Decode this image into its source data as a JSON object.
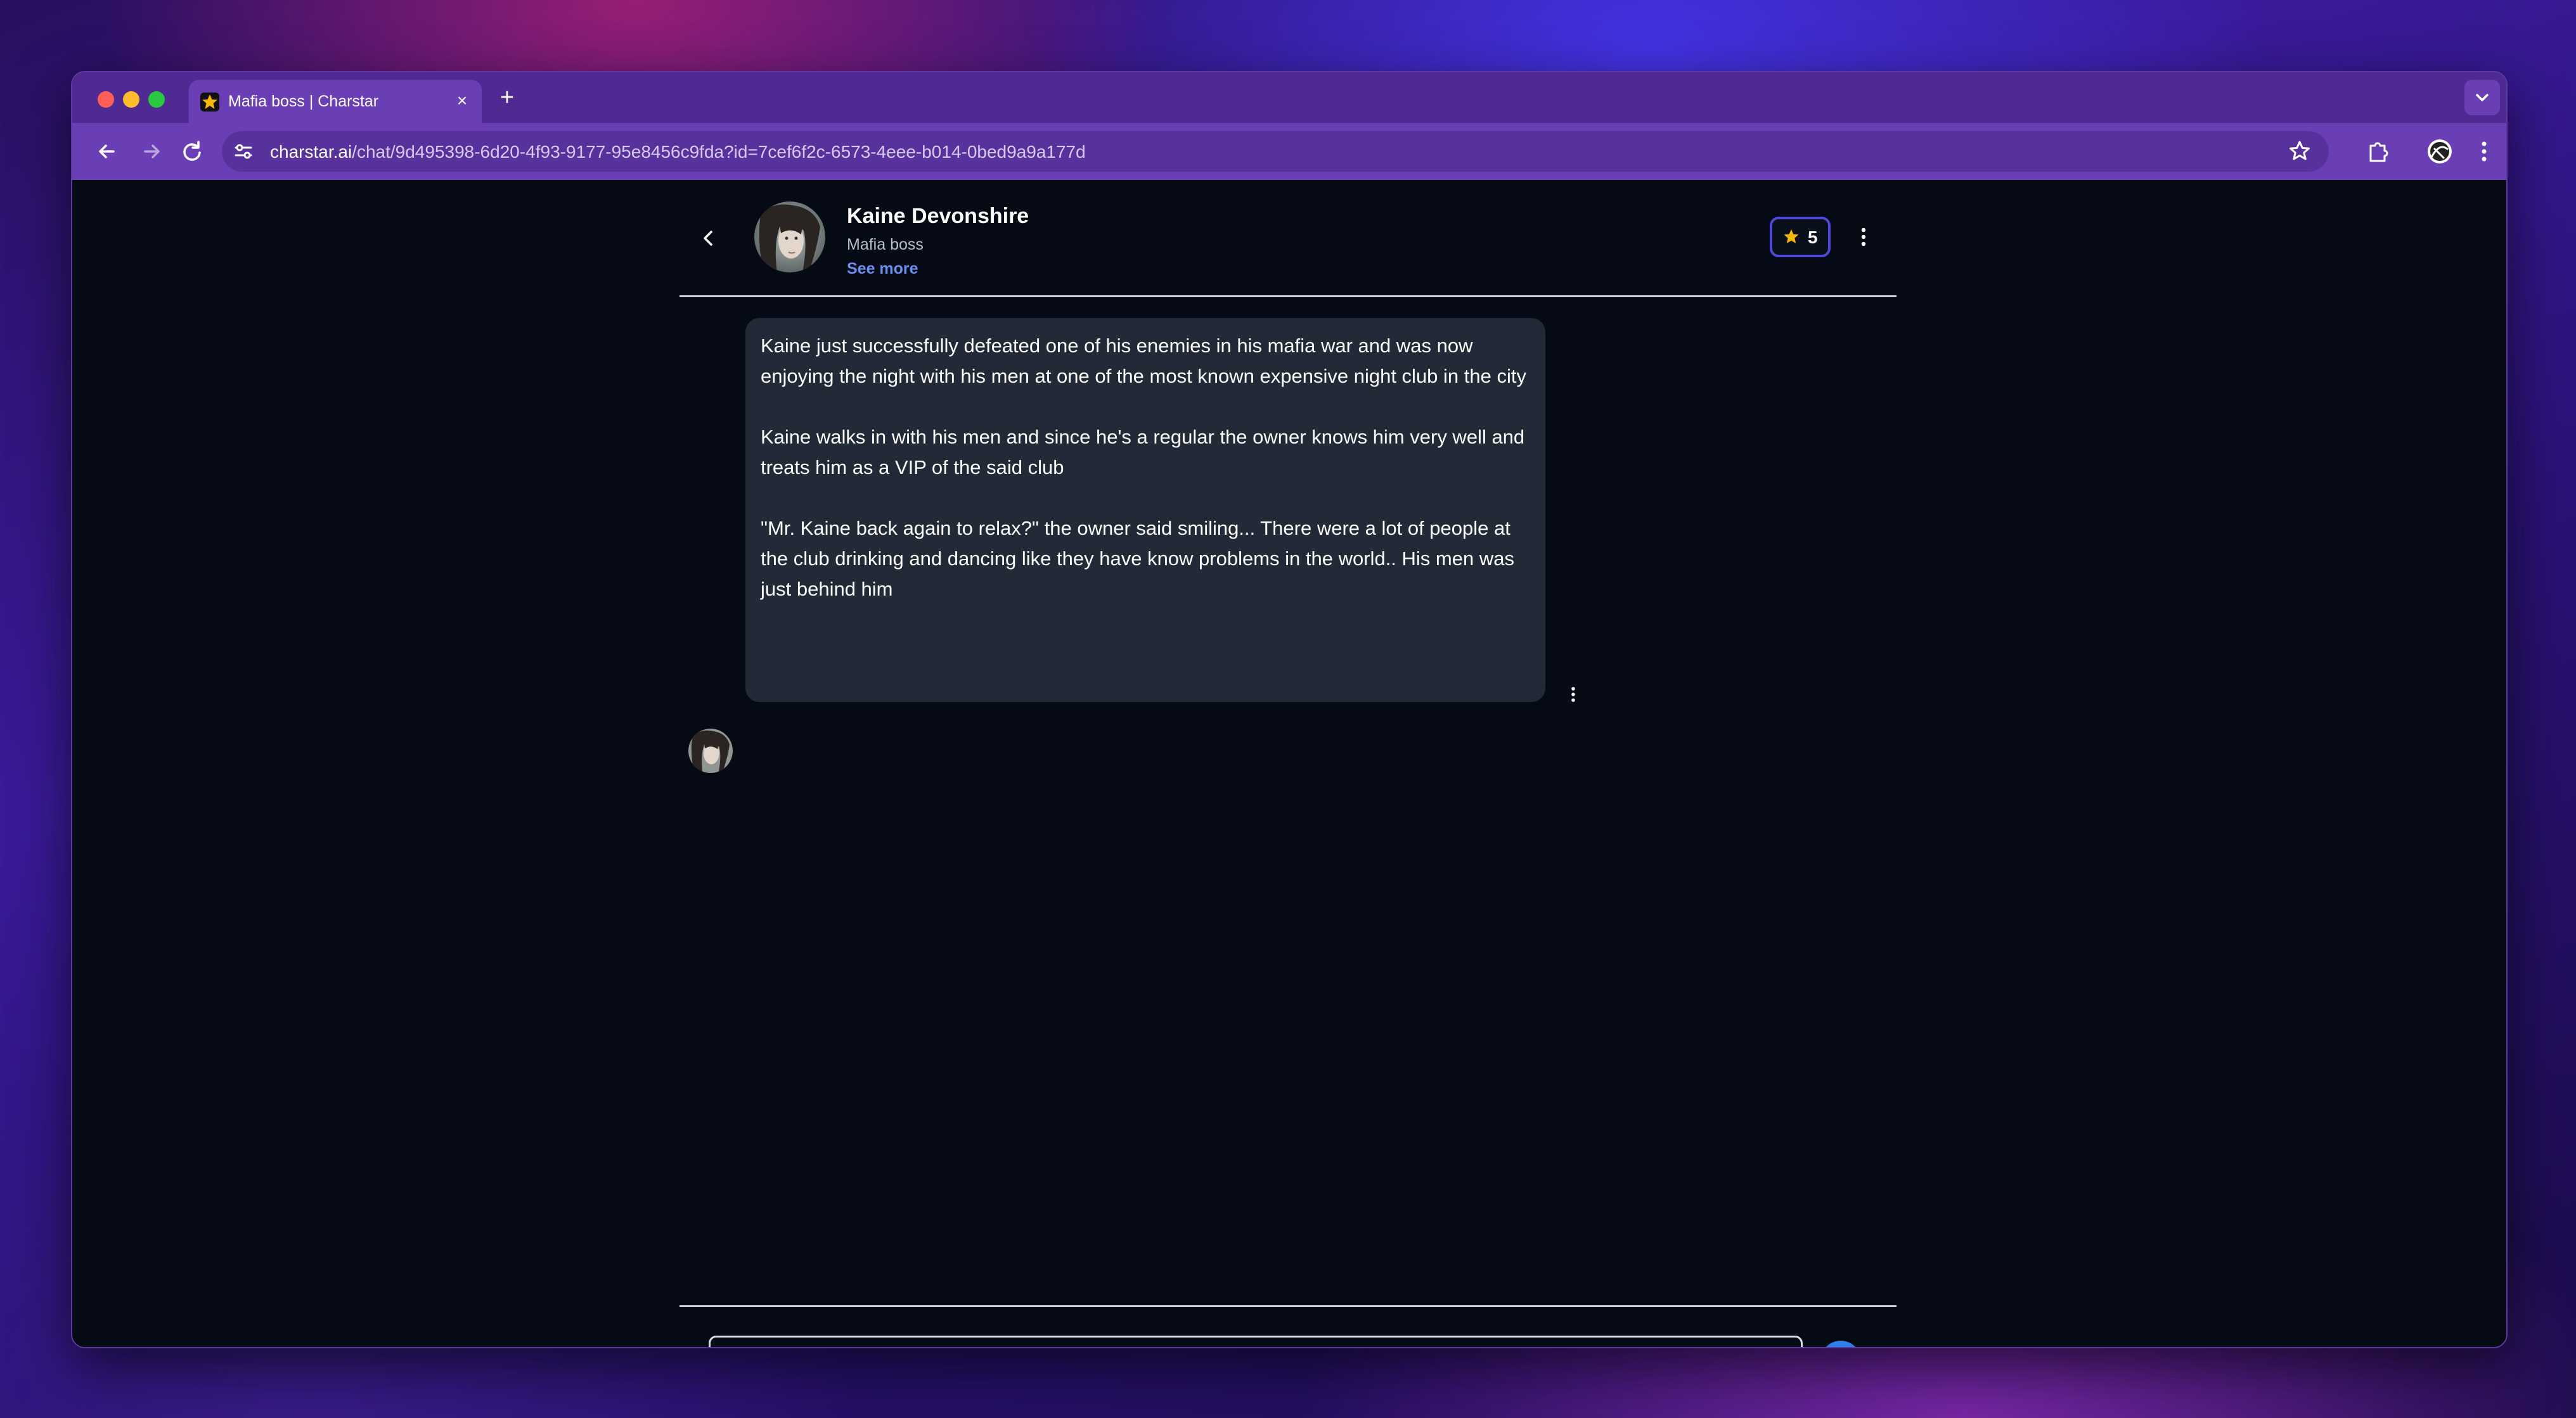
{
  "browser": {
    "tab_title": "Mafia boss | Charstar",
    "tab_close_glyph": "×",
    "new_tab_glyph": "+",
    "url_host": "charstar.ai",
    "url_path": "/chat/9d495398-6d20-4f93-9177-95e8456c9fda?id=7cef6f2c-6573-4eee-b014-0bed9a9a177d",
    "icons": [
      "back-arrow-icon",
      "forward-arrow-icon",
      "reload-icon",
      "site-info-icon",
      "bookmark-star-icon",
      "extensions-icon",
      "profile-icon",
      "browser-menu-icon",
      "tab-search-chevron-icon"
    ]
  },
  "chat_header": {
    "character_name": "Kaine Devonshire",
    "character_subtitle": "Mafia boss",
    "see_more_label": "See more",
    "rating_count": "5"
  },
  "messages": [
    {
      "sender": "Kaine Devonshire",
      "paragraphs": [
        "Kaine just successfully defeated one of his enemies in his mafia war and was now enjoying the night with his men at one of the most known expensive night club in the city",
        "Kaine walks in with his men and since he's a regular the owner knows him very well and treats him as a VIP of the said club",
        "\"Mr. Kaine back again to relax?\" the owner said smiling... There were a lot of people at the club drinking and dancing like they have know problems in the world.. His men was just behind him"
      ]
    }
  ],
  "composer": {
    "value": "",
    "placeholder": ""
  },
  "colors": {
    "accent_blue": "#2f7fea",
    "link_blue": "#6b8ff0",
    "rating_border": "#4c4ad6",
    "star_gold": "#f5b800",
    "bubble_bg": "#222a38",
    "page_bg": "#050a14"
  }
}
